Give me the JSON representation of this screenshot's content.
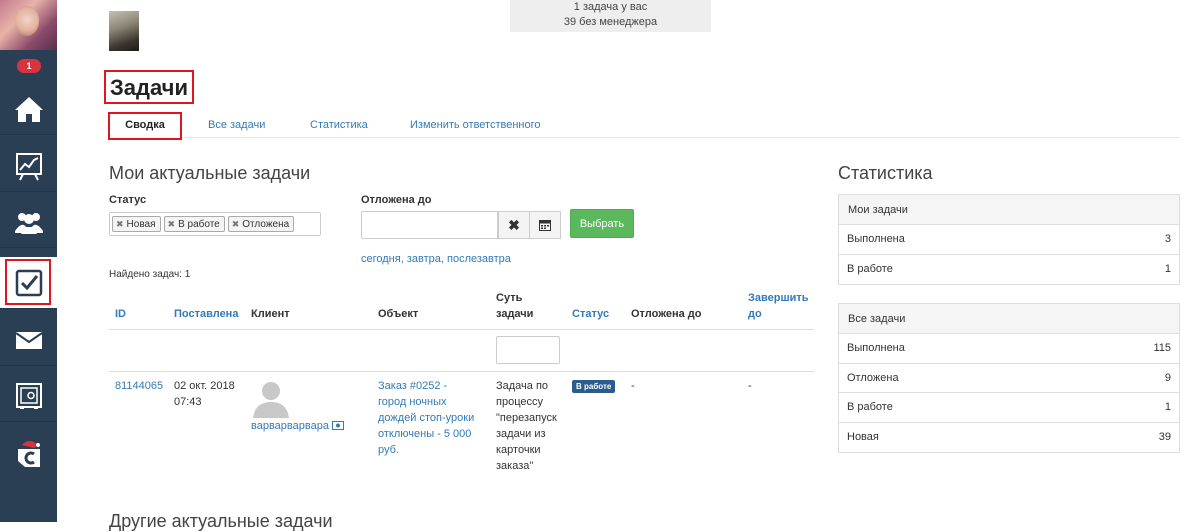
{
  "notifications_count": "1",
  "top_info": {
    "line1": "1 задача у вас",
    "line2": "39 без менеджера"
  },
  "page_title": "Задачи",
  "tabs": [
    {
      "label": "Сводка"
    },
    {
      "label": "Все задачи"
    },
    {
      "label": "Статистика"
    },
    {
      "label": "Изменить ответственного"
    }
  ],
  "my_tasks": {
    "title": "Мои актуальные задачи",
    "status_label": "Статус",
    "status_tags": [
      "Новая",
      "В работе",
      "Отложена"
    ],
    "postponed_label": "Отложена до",
    "postponed_value": "",
    "choose_button": "Выбрать",
    "quick_dates": {
      "today": "сегодня",
      "tomorrow": "завтра",
      "day_after": "послезавтра"
    },
    "found": "Найдено задач: 1"
  },
  "table": {
    "headers": {
      "id": "ID",
      "created": "Поставлена",
      "client": "Клиент",
      "object": "Объект",
      "essence_1": "Суть",
      "essence_2": "задачи",
      "status": "Статус",
      "postponed": "Отложена до",
      "finish_1": "Завершить",
      "finish_2": "до"
    },
    "filter_value": "",
    "rows": [
      {
        "id": "81144065",
        "created_1": "02 окт. 2018",
        "created_2": "07:43",
        "client": "варварварвара",
        "object_lines": [
          "Заказ #0252 -",
          "город ночных",
          "дождей стоп-уроки",
          "отключены - 5 000",
          "руб."
        ],
        "essence_lines": [
          "Задача по",
          "процессу",
          "\"перезапуск",
          "задачи из",
          "карточки",
          "заказа\""
        ],
        "status": "В работе",
        "postponed": "-",
        "finish": "-"
      }
    ]
  },
  "stats": {
    "title": "Статистика",
    "my": {
      "head": "Мои задачи",
      "rows": [
        {
          "label": "Выполнена",
          "value": "3"
        },
        {
          "label": "В работе",
          "value": "1"
        }
      ]
    },
    "all": {
      "head": "Все задачи",
      "rows": [
        {
          "label": "Выполнена",
          "value": "115"
        },
        {
          "label": "Отложена",
          "value": "9"
        },
        {
          "label": "В работе",
          "value": "1"
        },
        {
          "label": "Новая",
          "value": "39"
        }
      ]
    }
  },
  "other_tasks_title": "Другие актуальные задачи",
  "icons": {
    "nav": [
      "home-icon",
      "chart-icon",
      "users-icon",
      "tasks-checkbox-icon",
      "mail-icon",
      "safe-icon",
      "c-logo-icon"
    ]
  },
  "colors": {
    "sidebar": "#2a3f54",
    "link": "#337ab7",
    "highlight": "#e0161f",
    "green": "#5cb85c",
    "status_badge": "#2a5d8c"
  }
}
